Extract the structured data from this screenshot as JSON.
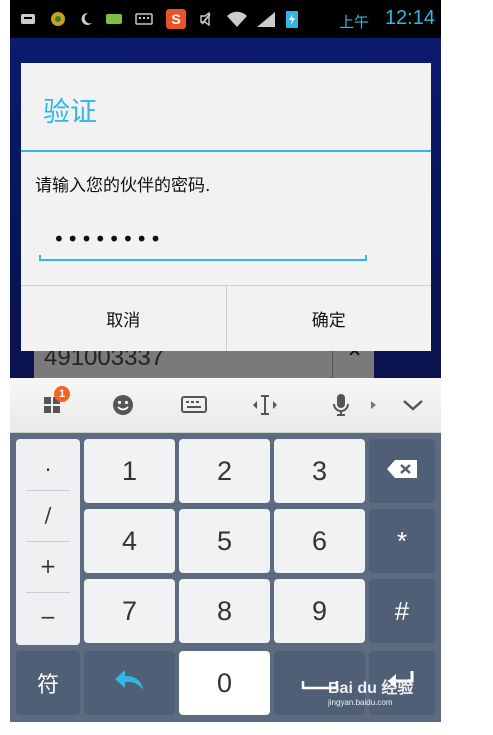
{
  "status_bar": {
    "ampm": "上午",
    "time": "12:14",
    "icons": [
      "keyboard-notification-icon",
      "app-icon",
      "moon-icon",
      "battery-saver-icon",
      "keyboard-icon",
      "sogou-icon",
      "mute-icon",
      "wifi-icon",
      "signal-icon",
      "battery-charging-icon"
    ],
    "sogou_letter": "S"
  },
  "background_app": {
    "field_value": "491003337",
    "up_glyph": "⌃"
  },
  "dialog": {
    "title": "验证",
    "message": "请输入您的伙伴的密码.",
    "password_masked": "••••••••",
    "cancel_label": "取消",
    "confirm_label": "确定"
  },
  "toolbar": {
    "badge_count": "1",
    "items": [
      "apps-icon",
      "emoji-icon",
      "keyboard-switch-icon",
      "cursor-icon",
      "microphone-icon",
      "collapse-icon"
    ]
  },
  "keypad": {
    "symbols": [
      ".",
      "/",
      "+",
      "−"
    ],
    "row1": [
      "1",
      "2",
      "3"
    ],
    "row2": [
      "4",
      "5",
      "6"
    ],
    "row3": [
      "7",
      "8",
      "9"
    ],
    "star": "*",
    "hash": "#",
    "sym_key": "符",
    "zero": "0"
  },
  "watermark": {
    "brand": "Bai du 经验",
    "url": "jingyan.baidu.com"
  },
  "colors": {
    "accent": "#33b5e5",
    "keypad_bg": "#5d6b80",
    "badge": "#f26522"
  }
}
